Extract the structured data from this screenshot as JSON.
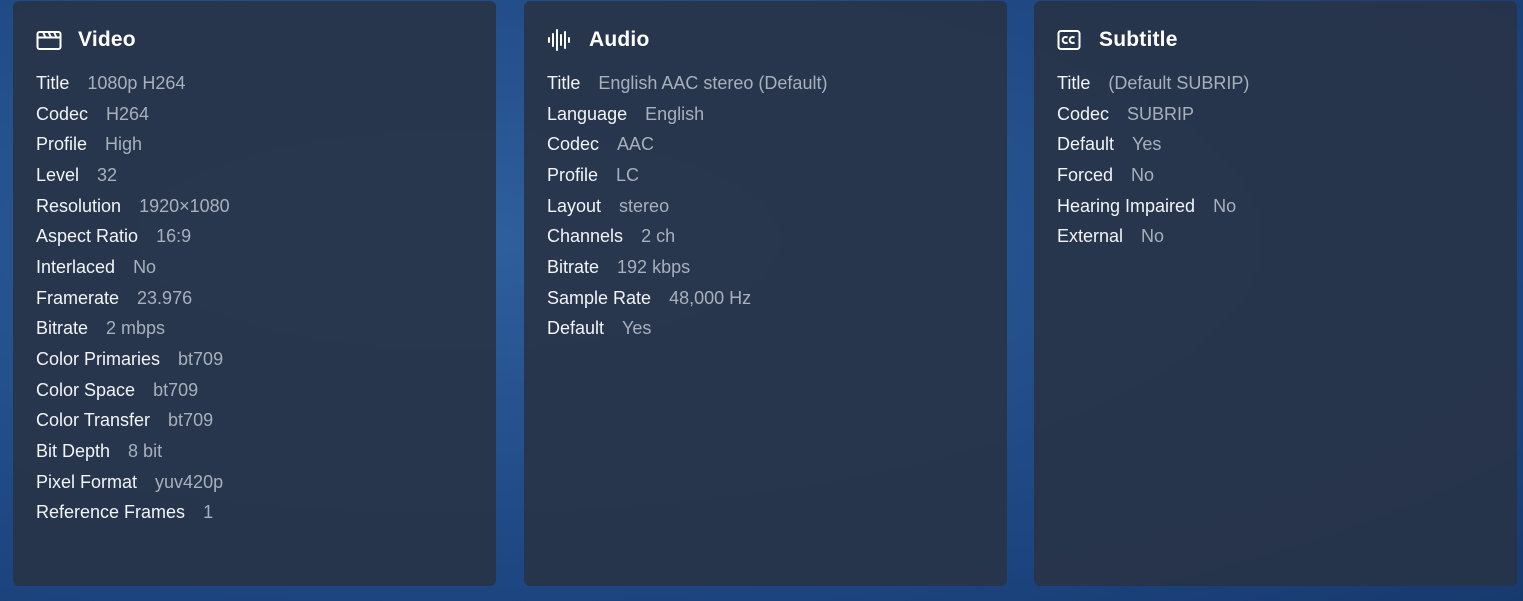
{
  "panels": {
    "video": {
      "title": "Video",
      "icon": "clapperboard-icon",
      "rows": [
        {
          "label": "Title",
          "value": "1080p H264"
        },
        {
          "label": "Codec",
          "value": "H264"
        },
        {
          "label": "Profile",
          "value": "High"
        },
        {
          "label": "Level",
          "value": "32"
        },
        {
          "label": "Resolution",
          "value": "1920×1080"
        },
        {
          "label": "Aspect Ratio",
          "value": "16:9"
        },
        {
          "label": "Interlaced",
          "value": "No"
        },
        {
          "label": "Framerate",
          "value": "23.976"
        },
        {
          "label": "Bitrate",
          "value": "2 mbps"
        },
        {
          "label": "Color Primaries",
          "value": "bt709"
        },
        {
          "label": "Color Space",
          "value": "bt709"
        },
        {
          "label": "Color Transfer",
          "value": "bt709"
        },
        {
          "label": "Bit Depth",
          "value": "8 bit"
        },
        {
          "label": "Pixel Format",
          "value": "yuv420p"
        },
        {
          "label": "Reference Frames",
          "value": "1"
        }
      ]
    },
    "audio": {
      "title": "Audio",
      "icon": "audio-waveform-icon",
      "rows": [
        {
          "label": "Title",
          "value": "English AAC stereo (Default)"
        },
        {
          "label": "Language",
          "value": "English"
        },
        {
          "label": "Codec",
          "value": "AAC"
        },
        {
          "label": "Profile",
          "value": "LC"
        },
        {
          "label": "Layout",
          "value": "stereo"
        },
        {
          "label": "Channels",
          "value": "2 ch"
        },
        {
          "label": "Bitrate",
          "value": "192 kbps"
        },
        {
          "label": "Sample Rate",
          "value": "48,000 Hz"
        },
        {
          "label": "Default",
          "value": "Yes"
        }
      ]
    },
    "subtitle": {
      "title": "Subtitle",
      "icon": "closed-captions-icon",
      "rows": [
        {
          "label": "Title",
          "value": "(Default SUBRIP)"
        },
        {
          "label": "Codec",
          "value": "SUBRIP"
        },
        {
          "label": "Default",
          "value": "Yes"
        },
        {
          "label": "Forced",
          "value": "No"
        },
        {
          "label": "Hearing Impaired",
          "value": "No"
        },
        {
          "label": "External",
          "value": "No"
        }
      ]
    }
  },
  "colors": {
    "panel_bg": "#283448",
    "label": "#f2f4f7",
    "value": "#a8b0bc",
    "background": "#24508c"
  }
}
